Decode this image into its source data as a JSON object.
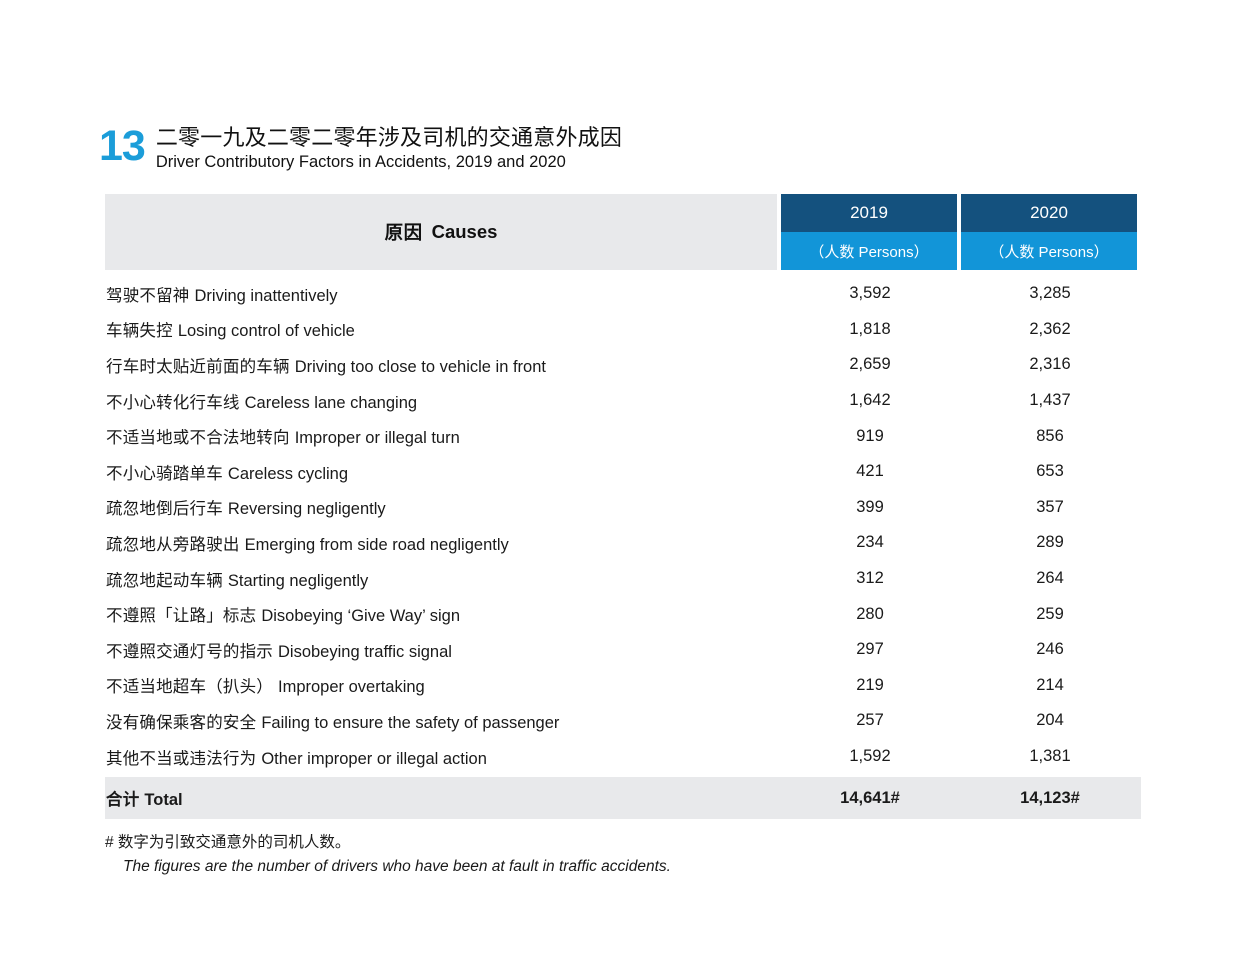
{
  "header": {
    "chapter_number": "13",
    "title_zh": "二零一九及二零二零年涉及司机的交通意外成因",
    "title_en": "Driver Contributory Factors in Accidents, 2019 and 2020",
    "accent_color": "#1b9dd9"
  },
  "table": {
    "causes_header_zh": "原因",
    "causes_header_en": "Causes",
    "causes_header_bg": "#e8e9eb",
    "year_header_bg": "#14517e",
    "unit_header_bg": "#1295d8",
    "columns": [
      {
        "year": "2019",
        "unit": "（人数 Persons）"
      },
      {
        "year": "2020",
        "unit": "（人数 Persons）"
      }
    ],
    "rows": [
      {
        "zh": "驾驶不留神",
        "en": "Driving inattentively",
        "v2019": "3,592",
        "v2020": "3,285"
      },
      {
        "zh": "车辆失控",
        "en": "Losing control of vehicle",
        "v2019": "1,818",
        "v2020": "2,362"
      },
      {
        "zh": "行车时太贴近前面的车辆",
        "en": "Driving too close to vehicle in front",
        "v2019": "2,659",
        "v2020": "2,316"
      },
      {
        "zh": "不小心转化行车线",
        "en": "Careless lane changing",
        "v2019": "1,642",
        "v2020": "1,437"
      },
      {
        "zh": "不适当地或不合法地转向",
        "en": "Improper or illegal turn",
        "v2019": "919",
        "v2020": "856"
      },
      {
        "zh": "不小心骑踏单车",
        "en": "Careless cycling",
        "v2019": "421",
        "v2020": "653"
      },
      {
        "zh": "疏忽地倒后行车",
        "en": "Reversing negligently",
        "v2019": "399",
        "v2020": "357"
      },
      {
        "zh": "疏忽地从旁路驶出",
        "en": "Emerging from side road negligently",
        "v2019": "234",
        "v2020": "289"
      },
      {
        "zh": "疏忽地起动车辆",
        "en": "Starting negligently",
        "v2019": "312",
        "v2020": "264"
      },
      {
        "zh": "不遵照「让路」标志",
        "en": "Disobeying ‘Give Way’ sign",
        "v2019": "280",
        "v2020": "259"
      },
      {
        "zh": "不遵照交通灯号的指示",
        "en": "Disobeying traffic signal",
        "v2019": "297",
        "v2020": "246"
      },
      {
        "zh": "不适当地超车（扒头）",
        "en": "Improper overtaking",
        "v2019": "219",
        "v2020": "214"
      },
      {
        "zh": "没有确保乘客的安全",
        "en": "Failing to ensure the safety of passenger",
        "v2019": "257",
        "v2020": "204"
      },
      {
        "zh": "其他不当或违法行为",
        "en": "Other improper or illegal action",
        "v2019": "1,592",
        "v2020": "1,381"
      }
    ],
    "total": {
      "zh": "合计",
      "en": "Total",
      "v2019": "14,641#",
      "v2020": "14,123#",
      "bg": "#e8e9eb"
    }
  },
  "footnote": {
    "zh": "# 数字为引致交通意外的司机人数。",
    "en": "The figures are the number of drivers who have been at fault in traffic accidents."
  },
  "chart_data": {
    "type": "table",
    "title": "Driver Contributory Factors in Accidents, 2019 and 2020",
    "categories": [
      "Driving inattentively",
      "Losing control of vehicle",
      "Driving too close to vehicle in front",
      "Careless lane changing",
      "Improper or illegal turn",
      "Careless cycling",
      "Reversing negligently",
      "Emerging from side road negligently",
      "Starting negligently",
      "Disobeying ‘Give Way’ sign",
      "Disobeying traffic signal",
      "Improper overtaking",
      "Failing to ensure the safety of passenger",
      "Other improper or illegal action"
    ],
    "series": [
      {
        "name": "2019",
        "values": [
          3592,
          1818,
          2659,
          1642,
          919,
          421,
          399,
          234,
          312,
          280,
          297,
          219,
          257,
          1592
        ],
        "total": 14641
      },
      {
        "name": "2020",
        "values": [
          3285,
          2362,
          2316,
          1437,
          856,
          653,
          357,
          289,
          264,
          259,
          246,
          214,
          204,
          1381
        ],
        "total": 14123
      }
    ],
    "ylabel": "Persons",
    "xlabel": "Causes"
  }
}
